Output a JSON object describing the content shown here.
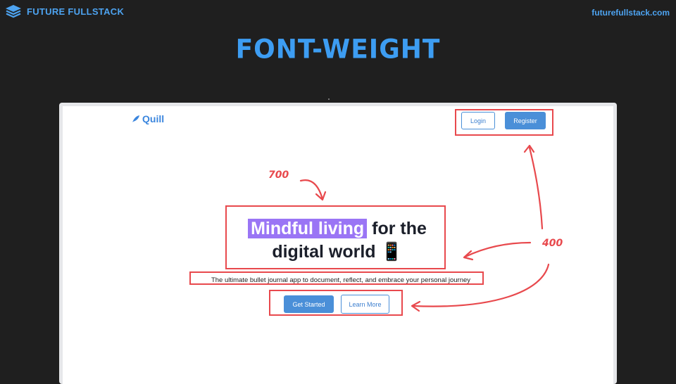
{
  "header": {
    "brand": "FUTURE FULLSTACK",
    "site_url": "futurefullstack.com",
    "slide_title": "FONT-WEIGHT"
  },
  "mockup": {
    "logo": "Quill",
    "nav": {
      "login": "Login",
      "register": "Register"
    },
    "headline_highlight": "Mindful living",
    "headline_line1_rest": "for the",
    "headline_line2": "digital world",
    "headline_emoji": "📱",
    "subtitle": "The ultimate bullet journal app to document, reflect, and embrace your personal journey",
    "cta": {
      "primary": "Get Started",
      "secondary": "Learn More"
    }
  },
  "annotations": {
    "label_bold": "700",
    "label_regular": "400"
  },
  "colors": {
    "background": "#1f1f1f",
    "brand_blue": "#4da3f0",
    "accent_purple": "#9a75f5",
    "button_blue": "#4a8fd8",
    "annotation_red": "#e8494d"
  }
}
